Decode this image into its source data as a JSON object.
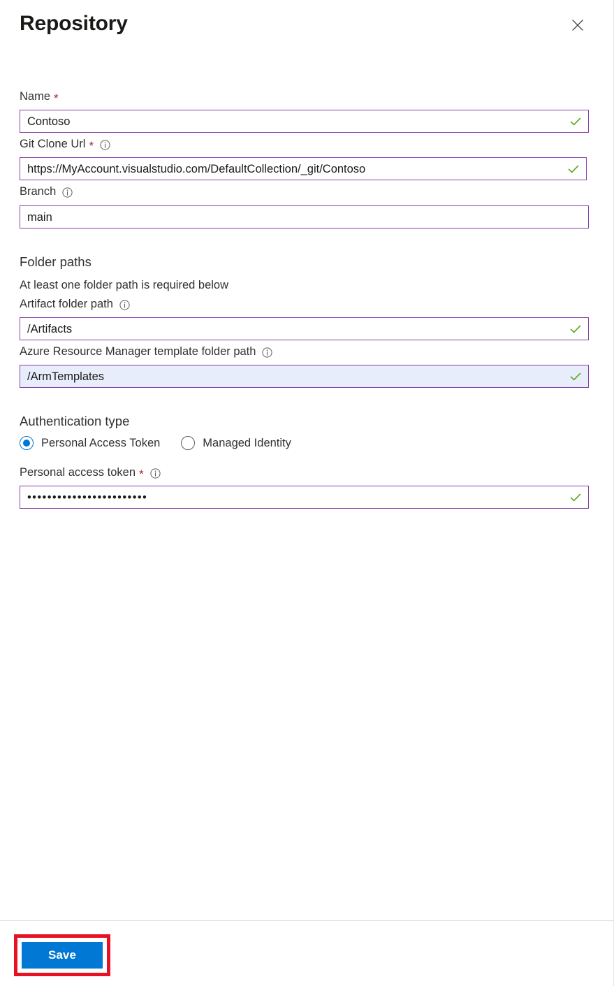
{
  "blade": {
    "title": "Repository",
    "close_icon": "close-icon"
  },
  "fields": {
    "name": {
      "label": "Name",
      "required_marker": "*",
      "value": "Contoso",
      "valid": true
    },
    "git_clone_url": {
      "label": "Git Clone Url",
      "required_marker": "*",
      "info_icon": "info-icon",
      "value": "https://MyAccount.visualstudio.com/DefaultCollection/_git/Contoso",
      "valid": true
    },
    "branch": {
      "label": "Branch",
      "info_icon": "info-icon",
      "value": "main",
      "valid": false
    }
  },
  "folder_paths": {
    "heading": "Folder paths",
    "description": "At least one folder path is required below",
    "artifact": {
      "label": "Artifact folder path",
      "info_icon": "info-icon",
      "value": "/Artifacts",
      "valid": true
    },
    "arm_template": {
      "label": "Azure Resource Manager template folder path",
      "info_icon": "info-icon",
      "value": "/ArmTemplates",
      "valid": true,
      "focused": true
    }
  },
  "authentication": {
    "heading": "Authentication type",
    "options": [
      {
        "label": "Personal Access Token",
        "selected": true
      },
      {
        "label": "Managed Identity",
        "selected": false
      }
    ],
    "token": {
      "label": "Personal access token",
      "required_marker": "*",
      "info_icon": "info-icon",
      "value": "••••••••••••••••••••••••",
      "valid": true
    }
  },
  "footer": {
    "save_label": "Save"
  },
  "colors": {
    "accent_blue": "#0078d4",
    "input_border_purple": "#8a3fa8",
    "valid_green": "#5aa416",
    "required_red": "#a4262c",
    "highlight_red": "#e81123",
    "focus_field_bg": "#e7edfa"
  }
}
